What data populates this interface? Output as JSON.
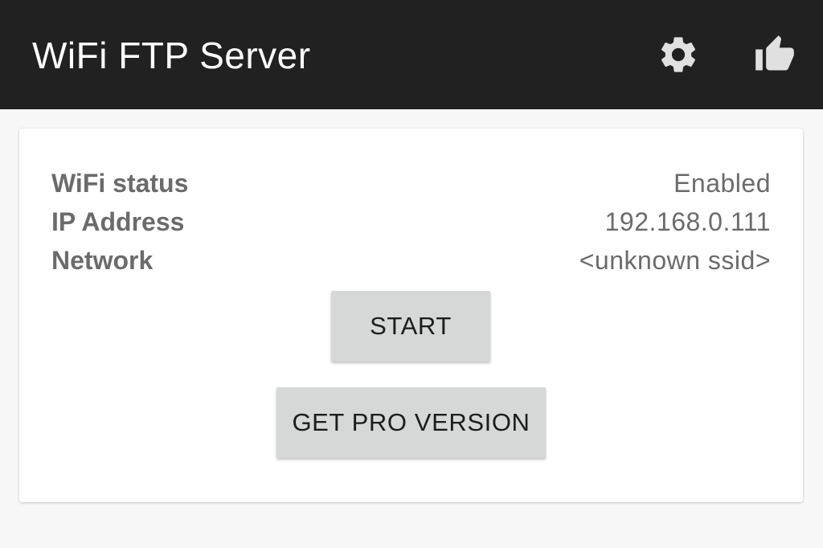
{
  "app_bar": {
    "title": "WiFi FTP Server",
    "actions": [
      {
        "name": "settings",
        "icon": "gear-icon"
      },
      {
        "name": "rate",
        "icon": "thumbs-up-icon"
      }
    ]
  },
  "status": {
    "rows": [
      {
        "label": "WiFi status",
        "value": "Enabled"
      },
      {
        "label": "IP Address",
        "value": "192.168.0.111"
      },
      {
        "label": "Network",
        "value": "<unknown ssid>"
      }
    ]
  },
  "buttons": {
    "start": "START",
    "pro": "GET PRO VERSION"
  },
  "colors": {
    "app_bar_bg": "#212121",
    "page_bg": "#f7f7f7",
    "card_bg": "#ffffff",
    "text_muted": "#6b6b6b",
    "button_bg": "#d6d7d7"
  }
}
